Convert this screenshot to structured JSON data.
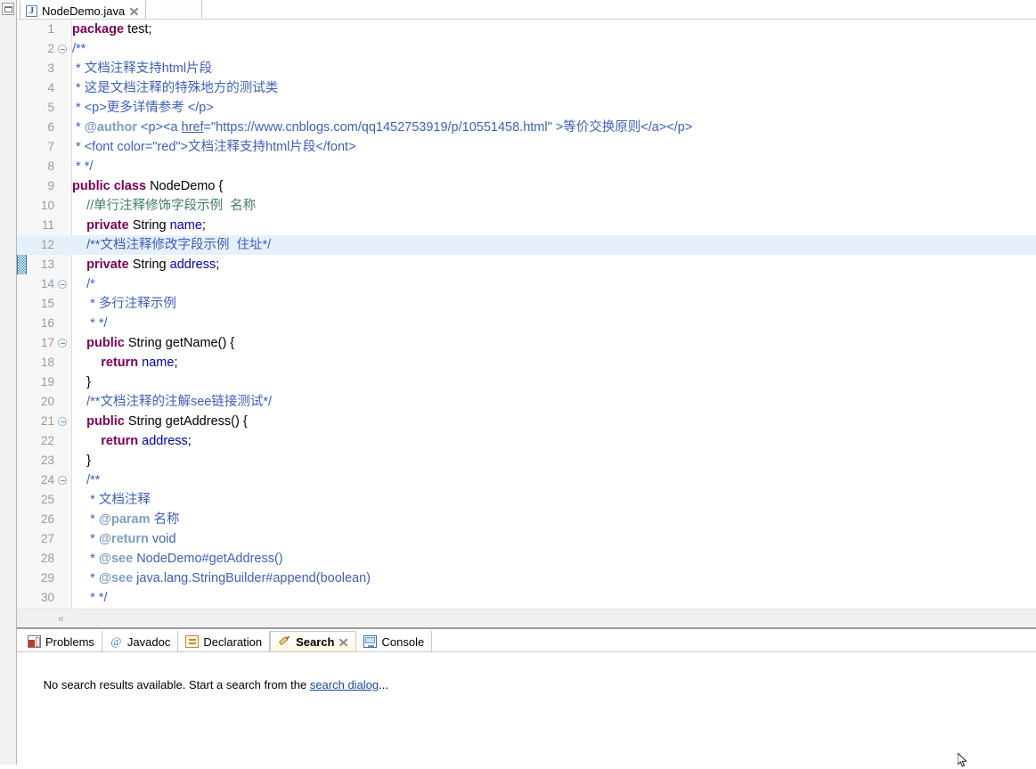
{
  "window": {
    "app": "Eclipse IDE",
    "restore_view_icon": "restore-view-icon"
  },
  "editor": {
    "tab": {
      "label": "NodeDemo.java",
      "file_icon": "java-file-icon",
      "close_icon": "close-icon",
      "active": true
    },
    "hscroll_arrow": "«",
    "current_line": 12,
    "change_marker_lines": [
      12,
      13
    ],
    "colors": {
      "keyword": "#7f0055",
      "field": "#0000c0",
      "javadoc": "#3f5fbf",
      "javadoc_tag": "#7f9fbf",
      "line_comment": "#3f7f5f",
      "current_line_bg": "#e6f0fa",
      "change_marker": "#3c8fc4",
      "line_number": "#9a9a9a"
    },
    "lines": [
      {
        "n": "1",
        "fold": false,
        "text": "package test;"
      },
      {
        "n": "2",
        "fold": true,
        "text": "/**"
      },
      {
        "n": "3",
        "fold": false,
        "text": " * 文档注释支持html片段"
      },
      {
        "n": "4",
        "fold": false,
        "text": " * 这是文档注释的特殊地方的测试类"
      },
      {
        "n": "5",
        "fold": false,
        "text": " * <p>更多详情参考 </p>"
      },
      {
        "n": "6",
        "fold": false,
        "text": " * @author <p><a href=\"https://www.cnblogs.com/qq1452753919/p/10551458.html\" >等价交换原则</a></p>"
      },
      {
        "n": "7",
        "fold": false,
        "text": " * <font color=\"red\">文档注释支持html片段</font>"
      },
      {
        "n": "8",
        "fold": false,
        "text": " * */"
      },
      {
        "n": "9",
        "fold": false,
        "text": "public class NodeDemo {"
      },
      {
        "n": "10",
        "fold": false,
        "text": "    //单行注释修饰字段示例  名称"
      },
      {
        "n": "11",
        "fold": false,
        "text": "    private String name;"
      },
      {
        "n": "12",
        "fold": false,
        "text": "    /**文档注释修改字段示例  住址*/"
      },
      {
        "n": "13",
        "fold": false,
        "text": "    private String address;"
      },
      {
        "n": "14",
        "fold": true,
        "text": "    /*"
      },
      {
        "n": "15",
        "fold": false,
        "text": "     * 多行注释示例"
      },
      {
        "n": "16",
        "fold": false,
        "text": "     * */"
      },
      {
        "n": "17",
        "fold": true,
        "text": "    public String getName() {"
      },
      {
        "n": "18",
        "fold": false,
        "text": "        return name;"
      },
      {
        "n": "19",
        "fold": false,
        "text": "    }"
      },
      {
        "n": "20",
        "fold": false,
        "text": "    /**文档注释的注解see链接测试*/"
      },
      {
        "n": "21",
        "fold": true,
        "text": "    public String getAddress() {"
      },
      {
        "n": "22",
        "fold": false,
        "text": "        return address;"
      },
      {
        "n": "23",
        "fold": false,
        "text": "    }"
      },
      {
        "n": "24",
        "fold": true,
        "text": "    /**"
      },
      {
        "n": "25",
        "fold": false,
        "text": "     * 文档注释"
      },
      {
        "n": "26",
        "fold": false,
        "text": "     * @param 名称"
      },
      {
        "n": "27",
        "fold": false,
        "text": "     * @return void"
      },
      {
        "n": "28",
        "fold": false,
        "text": "     * @see NodeDemo#getAddress()"
      },
      {
        "n": "29",
        "fold": false,
        "text": "     * @see java.lang.StringBuilder#append(boolean)"
      },
      {
        "n": "30",
        "fold": false,
        "text": "     * */"
      }
    ]
  },
  "bottom_view": {
    "tabs": [
      {
        "label": "Problems",
        "icon": "problems-icon",
        "active": false,
        "closable": false
      },
      {
        "label": "Javadoc",
        "icon": "javadoc-icon",
        "active": false,
        "closable": false
      },
      {
        "label": "Declaration",
        "icon": "declaration-icon",
        "active": false,
        "closable": false
      },
      {
        "label": "Search",
        "icon": "search-icon",
        "active": true,
        "closable": true
      },
      {
        "label": "Console",
        "icon": "console-icon",
        "active": false,
        "closable": false
      }
    ],
    "search": {
      "message_prefix": "No search results available. Start a search from the ",
      "link_text": "search dialog",
      "message_suffix": "..."
    }
  }
}
